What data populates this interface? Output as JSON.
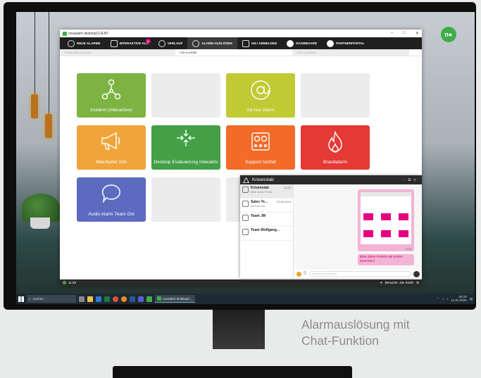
{
  "window": {
    "title": "novaalert desktopCLIENT"
  },
  "nav": [
    {
      "label": "NEUE ALARME",
      "icon": "user-icon"
    },
    {
      "label": "INTERAKTIVE ALA",
      "icon": "bell-icon",
      "badge": "4"
    },
    {
      "label": "VERLAUF",
      "icon": "history-icon"
    },
    {
      "label": "ALARM AUSLÖSEN",
      "icon": "alarm-trigger-icon"
    },
    {
      "label": "AN-/ ABMELDEN",
      "icon": "group-icon"
    },
    {
      "label": "DASHBOARD",
      "icon": "globe-icon"
    },
    {
      "label": "PARTNERPORTAL",
      "icon": "globe-icon"
    }
  ],
  "subtabs": [
    "STANDARD ALARME",
    "CIM ALARME",
    "TEST ALARME"
  ],
  "tiles": [
    {
      "label": "Incident (Interactive)",
      "color": "#7cb342",
      "icon": "network-icon"
    },
    {
      "label": "",
      "color": "#ececec",
      "icon": ""
    },
    {
      "label": "Ad hoc Alarm",
      "color": "#c0ca33",
      "icon": "at-icon"
    },
    {
      "label": "",
      "color": "#ececec",
      "icon": ""
    },
    {
      "label": "Mitarbeiter Info",
      "color": "#f0a43a",
      "icon": "megaphone-icon"
    },
    {
      "label": "Desktop Evakuierung Interaktiv",
      "color": "#43a047",
      "icon": "evacuation-icon"
    },
    {
      "label": "Support Notfall",
      "color": "#f26b28",
      "icon": "support-icon"
    },
    {
      "label": "Brandalarm",
      "color": "#e53935",
      "icon": "fire-icon"
    },
    {
      "label": "Audio Alarm Team Ost",
      "color": "#5c6bc0",
      "icon": "speech-bubble-icon"
    },
    {
      "label": "",
      "color": "#ececec",
      "icon": ""
    },
    {
      "label": "",
      "color": "#ececec",
      "icon": ""
    }
  ],
  "status": {
    "time": "11:29",
    "user": "Benutzer: Jim Smith"
  },
  "chat": {
    "title": "Krisenstab",
    "items": [
      {
        "name": "Krisenstab",
        "preview": "Bitte diese Punkt...",
        "time": "11:29"
      },
      {
        "name": "Sales Te...",
        "preview": "Michael Hu...",
        "time": "23.08.2024"
      },
      {
        "name": "Team JM",
        "preview": "",
        "time": ""
      },
      {
        "name": "Team Wolfgang...",
        "preview": "",
        "time": ""
      }
    ],
    "image_time": "11:28",
    "message": "Bitte diese Punkte als erstes beachten!",
    "message_time": "11:29",
    "input_placeholder": "Nachricht schreiben..."
  },
  "taskbar": {
    "search": "Suchen",
    "app": "novaalert desktopC...",
    "clock_time": "09:29",
    "clock_date": "11.02.2025"
  },
  "caption": {
    "line1": "Alarmauslösung mit",
    "line2": "Chat-Funktion"
  }
}
